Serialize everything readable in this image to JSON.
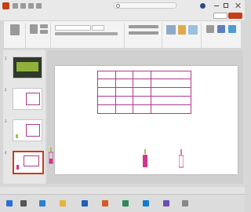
{
  "app": {
    "doc_title": "",
    "search_placeholder": "",
    "comments_label": "",
    "share_label": ""
  },
  "menu_tabs": [
    ""
  ],
  "slides": [
    1,
    2,
    3,
    4
  ],
  "table": {
    "headers": [
      "",
      "",
      "",
      ""
    ],
    "rows": [
      [
        "",
        "",
        "",
        ""
      ],
      [
        "",
        "",
        "",
        ""
      ],
      [
        "",
        "",
        "",
        ""
      ],
      [
        "",
        "",
        "",
        ""
      ]
    ]
  },
  "status": {
    "left": "",
    "right": ""
  },
  "taskbar": {
    "clock": ""
  },
  "colors": {
    "accent": "#c43e1c",
    "table_border": "#b03a8c",
    "figure": "#d4338f"
  }
}
